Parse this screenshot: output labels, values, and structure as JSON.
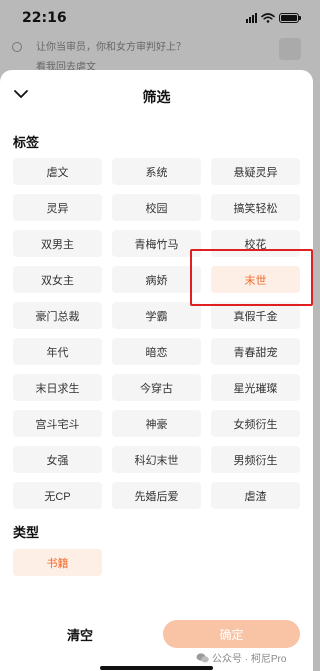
{
  "status_bar": {
    "time": "22:16"
  },
  "background_page": {
    "line1": "让你当审员，你和女方审判好上？",
    "line2": "看我回去虐文"
  },
  "sheet": {
    "title": "筛选",
    "tags_section": {
      "title": "标签",
      "tags": [
        {
          "label": "虐文",
          "selected": false
        },
        {
          "label": "系统",
          "selected": false
        },
        {
          "label": "悬疑灵异",
          "selected": false
        },
        {
          "label": "灵异",
          "selected": false
        },
        {
          "label": "校园",
          "selected": false
        },
        {
          "label": "搞笑轻松",
          "selected": false
        },
        {
          "label": "双男主",
          "selected": false
        },
        {
          "label": "青梅竹马",
          "selected": false
        },
        {
          "label": "校花",
          "selected": false
        },
        {
          "label": "双女主",
          "selected": false
        },
        {
          "label": "病娇",
          "selected": false
        },
        {
          "label": "末世",
          "selected": true
        },
        {
          "label": "豪门总裁",
          "selected": false
        },
        {
          "label": "学霸",
          "selected": false
        },
        {
          "label": "真假千金",
          "selected": false
        },
        {
          "label": "年代",
          "selected": false
        },
        {
          "label": "暗恋",
          "selected": false
        },
        {
          "label": "青春甜宠",
          "selected": false
        },
        {
          "label": "末日求生",
          "selected": false
        },
        {
          "label": "今穿古",
          "selected": false
        },
        {
          "label": "星光璀璨",
          "selected": false
        },
        {
          "label": "宫斗宅斗",
          "selected": false
        },
        {
          "label": "神豪",
          "selected": false
        },
        {
          "label": "女频衍生",
          "selected": false
        },
        {
          "label": "女强",
          "selected": false
        },
        {
          "label": "科幻末世",
          "selected": false
        },
        {
          "label": "男频衍生",
          "selected": false
        },
        {
          "label": "无CP",
          "selected": false
        },
        {
          "label": "先婚后爱",
          "selected": false
        },
        {
          "label": "虐渣",
          "selected": false
        }
      ]
    },
    "type_section": {
      "title": "类型",
      "options": [
        {
          "label": "书籍",
          "selected": true
        }
      ]
    },
    "footer": {
      "clear_label": "清空",
      "confirm_label": "确定",
      "watermark": "公众号 · 柯尼Pro"
    }
  },
  "colors": {
    "accent": "#f06a2a",
    "accent_bg": "#fdeee6",
    "tag_bg": "#f5f5f5",
    "confirm_bg": "#f9c3a6",
    "highlight_border": "#e02020"
  },
  "icons": {
    "close": "chevron-down-icon",
    "wifi": "wifi-icon",
    "battery": "battery-icon",
    "signal": "signal-icon",
    "wechat": "wechat-icon"
  }
}
